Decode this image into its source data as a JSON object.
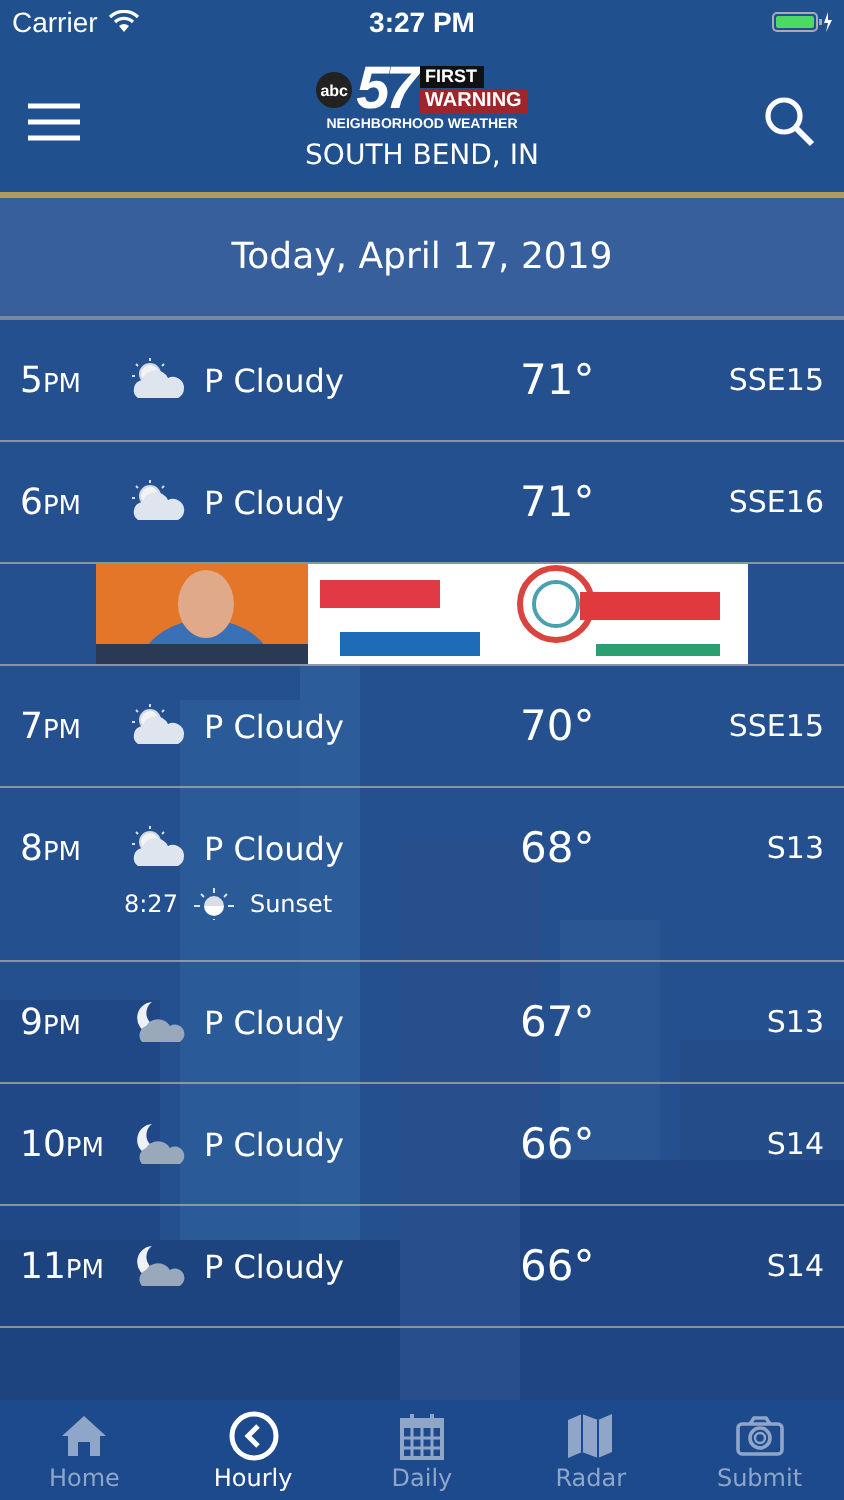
{
  "status_bar": {
    "carrier": "Carrier",
    "time": "3:27 PM"
  },
  "header": {
    "logo": {
      "network": "abc",
      "channel": "57",
      "line_1": "FIRST",
      "line_2": "WARNING",
      "tagline": "NEIGHBORHOOD WEATHER"
    },
    "location": "SOUTH BEND, IN"
  },
  "date_header": "Today, April 17, 2019",
  "rows": [
    {
      "kind": "hour",
      "hour": "5",
      "suffix": "PM",
      "night": false,
      "condition": "P Cloudy",
      "temp": "71°",
      "wind": "SSE15"
    },
    {
      "kind": "hour",
      "hour": "6",
      "suffix": "PM",
      "night": false,
      "condition": "P Cloudy",
      "temp": "71°",
      "wind": "SSE16"
    },
    {
      "kind": "ad"
    },
    {
      "kind": "hour",
      "hour": "7",
      "suffix": "PM",
      "night": false,
      "condition": "P Cloudy",
      "temp": "70°",
      "wind": "SSE15"
    },
    {
      "kind": "hour",
      "hour": "8",
      "suffix": "PM",
      "night": false,
      "condition": "P Cloudy",
      "temp": "68°",
      "wind": "S13",
      "event": {
        "time": "8:27",
        "label": "Sunset"
      }
    },
    {
      "kind": "hour",
      "hour": "9",
      "suffix": "PM",
      "night": true,
      "condition": "P Cloudy",
      "temp": "67°",
      "wind": "S13"
    },
    {
      "kind": "hour",
      "hour": "10",
      "suffix": "PM",
      "night": true,
      "condition": "P Cloudy",
      "temp": "66°",
      "wind": "S14"
    },
    {
      "kind": "hour",
      "hour": "11",
      "suffix": "PM",
      "night": true,
      "condition": "P Cloudy",
      "temp": "66°",
      "wind": "S14"
    }
  ],
  "tabs": [
    {
      "label": "Home",
      "kind": "home",
      "selected": false
    },
    {
      "label": "Hourly",
      "kind": "clock",
      "selected": true
    },
    {
      "label": "Daily",
      "kind": "calendar",
      "selected": false
    },
    {
      "label": "Radar",
      "kind": "map",
      "selected": false
    },
    {
      "label": "Submit",
      "kind": "camera",
      "selected": false
    }
  ]
}
